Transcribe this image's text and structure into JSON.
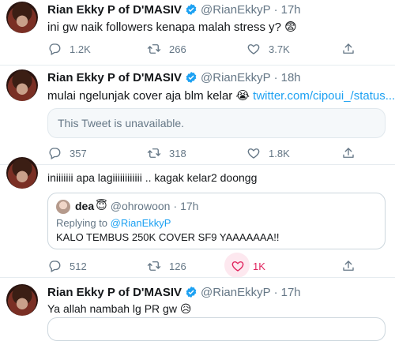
{
  "tweets": [
    {
      "name": "Rian Ekky P of D'MASIV",
      "handle": "@RianEkkyP",
      "time": "17h",
      "text": "ini gw naik followers kenapa malah stress y? 😨",
      "replies": "1.2K",
      "retweets": "266",
      "likes": "3.7K"
    },
    {
      "name": "Rian Ekky P of D'MASIV",
      "handle": "@RianEkkyP",
      "time": "18h",
      "text": "mulai ngelunjak cover aja blm kelar 😭 ",
      "link": "twitter.com/cipoui_/status...",
      "unavailable": "This Tweet is unavailable.",
      "replies": "357",
      "retweets": "318",
      "likes": "1.8K"
    },
    {
      "text": "iniiiiiii apa lagiiiiiiiiiiii .. kagak kelar2 doongg",
      "quote": {
        "name": "dea",
        "handle": "@ohrowoon",
        "time": "17h",
        "replying_to": "Replying to ",
        "replying_handle": "@RianEkkyP",
        "text": "KALO TEMBUS 250K COVER SF9 YAAAAAAA!!"
      },
      "replies": "512",
      "retweets": "126",
      "likes": "1K"
    },
    {
      "name": "Rian Ekky P of D'MASIV",
      "handle": "@RianEkkyP",
      "time": "17h",
      "text": "Ya allah nambah lg PR gw 😥"
    }
  ],
  "colors": {
    "accent": "#1da1f2",
    "like": "#e0245e",
    "muted": "#657786"
  }
}
